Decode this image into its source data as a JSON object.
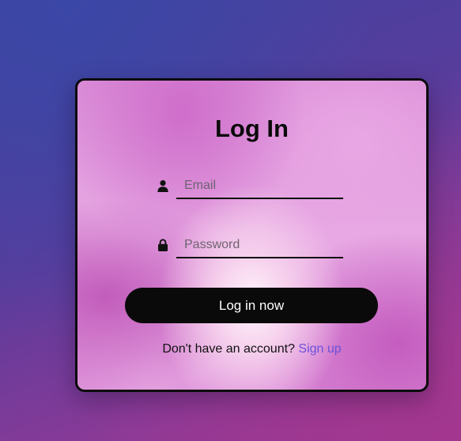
{
  "login": {
    "title": "Log In",
    "email": {
      "placeholder": "Email",
      "value": "",
      "icon": "user-icon"
    },
    "password": {
      "placeholder": "Password",
      "value": "",
      "icon": "lock-icon"
    },
    "submit_label": "Log in now",
    "signup_prompt": "Don't have an account?",
    "signup_link": "Sign up"
  },
  "colors": {
    "button_bg": "#0a0a0a",
    "button_text": "#ffffff",
    "link": "#6b52dc",
    "card_border": "#0b0b0b"
  }
}
